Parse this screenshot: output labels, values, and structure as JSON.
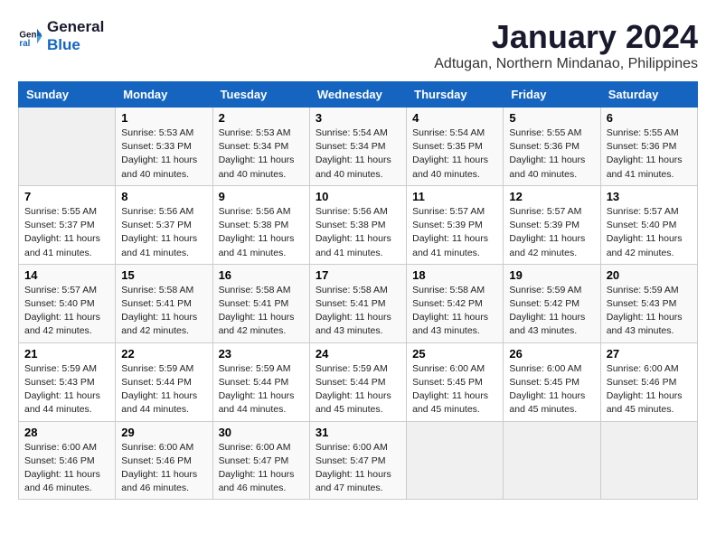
{
  "logo": {
    "line1": "General",
    "line2": "Blue"
  },
  "title": "January 2024",
  "subtitle": "Adtugan, Northern Mindanao, Philippines",
  "header": {
    "days": [
      "Sunday",
      "Monday",
      "Tuesday",
      "Wednesday",
      "Thursday",
      "Friday",
      "Saturday"
    ]
  },
  "weeks": [
    [
      {
        "num": "",
        "info": ""
      },
      {
        "num": "1",
        "info": "Sunrise: 5:53 AM\nSunset: 5:33 PM\nDaylight: 11 hours\nand 40 minutes."
      },
      {
        "num": "2",
        "info": "Sunrise: 5:53 AM\nSunset: 5:34 PM\nDaylight: 11 hours\nand 40 minutes."
      },
      {
        "num": "3",
        "info": "Sunrise: 5:54 AM\nSunset: 5:34 PM\nDaylight: 11 hours\nand 40 minutes."
      },
      {
        "num": "4",
        "info": "Sunrise: 5:54 AM\nSunset: 5:35 PM\nDaylight: 11 hours\nand 40 minutes."
      },
      {
        "num": "5",
        "info": "Sunrise: 5:55 AM\nSunset: 5:36 PM\nDaylight: 11 hours\nand 40 minutes."
      },
      {
        "num": "6",
        "info": "Sunrise: 5:55 AM\nSunset: 5:36 PM\nDaylight: 11 hours\nand 41 minutes."
      }
    ],
    [
      {
        "num": "7",
        "info": "Sunrise: 5:55 AM\nSunset: 5:37 PM\nDaylight: 11 hours\nand 41 minutes."
      },
      {
        "num": "8",
        "info": "Sunrise: 5:56 AM\nSunset: 5:37 PM\nDaylight: 11 hours\nand 41 minutes."
      },
      {
        "num": "9",
        "info": "Sunrise: 5:56 AM\nSunset: 5:38 PM\nDaylight: 11 hours\nand 41 minutes."
      },
      {
        "num": "10",
        "info": "Sunrise: 5:56 AM\nSunset: 5:38 PM\nDaylight: 11 hours\nand 41 minutes."
      },
      {
        "num": "11",
        "info": "Sunrise: 5:57 AM\nSunset: 5:39 PM\nDaylight: 11 hours\nand 41 minutes."
      },
      {
        "num": "12",
        "info": "Sunrise: 5:57 AM\nSunset: 5:39 PM\nDaylight: 11 hours\nand 42 minutes."
      },
      {
        "num": "13",
        "info": "Sunrise: 5:57 AM\nSunset: 5:40 PM\nDaylight: 11 hours\nand 42 minutes."
      }
    ],
    [
      {
        "num": "14",
        "info": "Sunrise: 5:57 AM\nSunset: 5:40 PM\nDaylight: 11 hours\nand 42 minutes."
      },
      {
        "num": "15",
        "info": "Sunrise: 5:58 AM\nSunset: 5:41 PM\nDaylight: 11 hours\nand 42 minutes."
      },
      {
        "num": "16",
        "info": "Sunrise: 5:58 AM\nSunset: 5:41 PM\nDaylight: 11 hours\nand 42 minutes."
      },
      {
        "num": "17",
        "info": "Sunrise: 5:58 AM\nSunset: 5:41 PM\nDaylight: 11 hours\nand 43 minutes."
      },
      {
        "num": "18",
        "info": "Sunrise: 5:58 AM\nSunset: 5:42 PM\nDaylight: 11 hours\nand 43 minutes."
      },
      {
        "num": "19",
        "info": "Sunrise: 5:59 AM\nSunset: 5:42 PM\nDaylight: 11 hours\nand 43 minutes."
      },
      {
        "num": "20",
        "info": "Sunrise: 5:59 AM\nSunset: 5:43 PM\nDaylight: 11 hours\nand 43 minutes."
      }
    ],
    [
      {
        "num": "21",
        "info": "Sunrise: 5:59 AM\nSunset: 5:43 PM\nDaylight: 11 hours\nand 44 minutes."
      },
      {
        "num": "22",
        "info": "Sunrise: 5:59 AM\nSunset: 5:44 PM\nDaylight: 11 hours\nand 44 minutes."
      },
      {
        "num": "23",
        "info": "Sunrise: 5:59 AM\nSunset: 5:44 PM\nDaylight: 11 hours\nand 44 minutes."
      },
      {
        "num": "24",
        "info": "Sunrise: 5:59 AM\nSunset: 5:44 PM\nDaylight: 11 hours\nand 45 minutes."
      },
      {
        "num": "25",
        "info": "Sunrise: 6:00 AM\nSunset: 5:45 PM\nDaylight: 11 hours\nand 45 minutes."
      },
      {
        "num": "26",
        "info": "Sunrise: 6:00 AM\nSunset: 5:45 PM\nDaylight: 11 hours\nand 45 minutes."
      },
      {
        "num": "27",
        "info": "Sunrise: 6:00 AM\nSunset: 5:46 PM\nDaylight: 11 hours\nand 45 minutes."
      }
    ],
    [
      {
        "num": "28",
        "info": "Sunrise: 6:00 AM\nSunset: 5:46 PM\nDaylight: 11 hours\nand 46 minutes."
      },
      {
        "num": "29",
        "info": "Sunrise: 6:00 AM\nSunset: 5:46 PM\nDaylight: 11 hours\nand 46 minutes."
      },
      {
        "num": "30",
        "info": "Sunrise: 6:00 AM\nSunset: 5:47 PM\nDaylight: 11 hours\nand 46 minutes."
      },
      {
        "num": "31",
        "info": "Sunrise: 6:00 AM\nSunset: 5:47 PM\nDaylight: 11 hours\nand 47 minutes."
      },
      {
        "num": "",
        "info": ""
      },
      {
        "num": "",
        "info": ""
      },
      {
        "num": "",
        "info": ""
      }
    ]
  ]
}
